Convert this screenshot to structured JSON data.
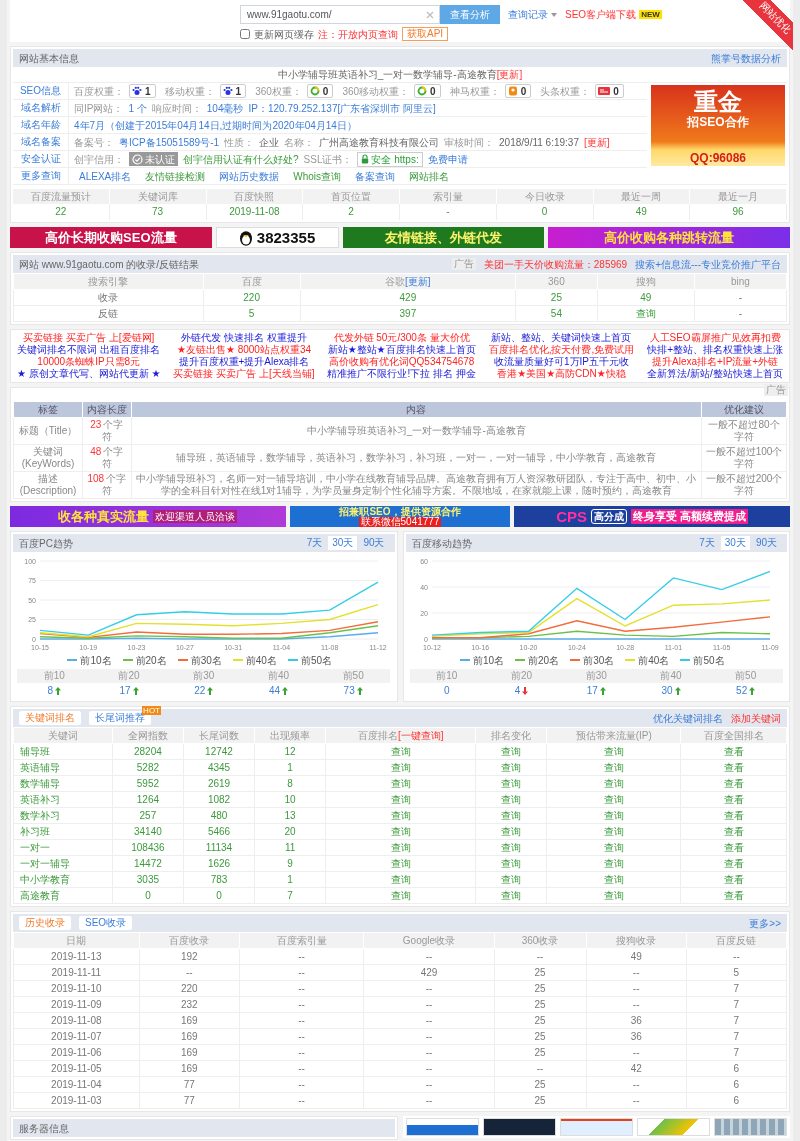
{
  "corner_ribbon": "网站优化",
  "search": {
    "value": "www.91gaotu.com/",
    "button": "查看分析",
    "history": "查询记录",
    "download": "SEO客户端下载",
    "download_badge": "NEW",
    "cache": {
      "label": "更新网页缓存",
      "checked": false
    },
    "note": "注：开放内页查询",
    "api": "获取API"
  },
  "basic_info": {
    "title": "网站基本信息",
    "link": "熊掌号数据分析",
    "site_title": "中小学辅导班英语补习_一对一数学辅导-高途教育",
    "site_update": "[更新]",
    "rows": [
      {
        "label": "SEO信息",
        "items": [
          {
            "kind": "label",
            "text": "百度权重："
          },
          {
            "kind": "weight",
            "text": "1"
          },
          {
            "kind": "label",
            "text": "移动权重："
          },
          {
            "kind": "weight",
            "text": "1"
          },
          {
            "kind": "label",
            "text": "360权重："
          },
          {
            "kind": "weight",
            "text": "0"
          },
          {
            "kind": "label",
            "text": "360移动权重："
          },
          {
            "kind": "weight",
            "text": "0"
          },
          {
            "kind": "label",
            "text": "神马权重："
          },
          {
            "kind": "weight",
            "text": "0"
          },
          {
            "kind": "label",
            "text": "头条权重："
          },
          {
            "kind": "weight",
            "text": "0"
          }
        ]
      },
      {
        "label": "域名解析",
        "items": [
          {
            "kind": "label",
            "text": "同IP网站："
          },
          {
            "kind": "value",
            "text": "1 个"
          },
          {
            "kind": "label",
            "text": "响应时间："
          },
          {
            "kind": "value",
            "text": "104毫秒"
          },
          {
            "kind": "value",
            "text": "IP：120.79.252.137[广东省深圳市 阿里云]"
          }
        ]
      },
      {
        "label": "域名年龄",
        "items": [
          {
            "kind": "value",
            "text": "4年7月（创建于2015年04月14日,过期时间为2020年04月14日）"
          }
        ]
      },
      {
        "label": "域名备案",
        "items": [
          {
            "kind": "label",
            "text": "备案号："
          },
          {
            "kind": "link",
            "text": "粤ICP备15051589号-1"
          },
          {
            "kind": "label",
            "text": "性质："
          },
          {
            "kind": "plain",
            "text": "企业"
          },
          {
            "kind": "label",
            "text": "名称："
          },
          {
            "kind": "plain",
            "text": "广州高途教育科技有限公司"
          },
          {
            "kind": "label",
            "text": "审核时间："
          },
          {
            "kind": "plain",
            "text": "2018/9/11 6:19:37"
          },
          {
            "kind": "update",
            "text": "[更新]"
          }
        ]
      },
      {
        "label": "安全认证",
        "items": [
          {
            "kind": "label",
            "text": "创宇信用："
          },
          {
            "kind": "cert",
            "text": "未认证"
          },
          {
            "kind": "green-link",
            "text": "创宇信用认证有什么好处?"
          },
          {
            "kind": "label",
            "text": "SSL证书："
          },
          {
            "kind": "ssl",
            "text": "安全 https:"
          },
          {
            "kind": "link",
            "text": "免费申请"
          }
        ]
      },
      {
        "label": "更多查询",
        "items": [
          {
            "kind": "link",
            "text": "ALEXA排名"
          },
          {
            "kind": "green-link",
            "text": "友情链接检测"
          },
          {
            "kind": "link",
            "text": "网站历史数据"
          },
          {
            "kind": "green-link",
            "text": "Whois查询"
          },
          {
            "kind": "link",
            "text": "备案查询"
          },
          {
            "kind": "green-link",
            "text": "网站排名"
          }
        ]
      }
    ],
    "ad": {
      "lines": [
        "重金",
        "招SEO合作",
        "QQ:96086"
      ]
    }
  },
  "stats": {
    "columns": [
      "百度流量预计",
      "关键词库",
      "百度快照",
      "首页位置",
      "索引量",
      "今日收录",
      "最近一周",
      "最近一月"
    ],
    "values": [
      "22",
      "73",
      "2019-11-08",
      "2",
      "-",
      "0",
      "49",
      "96"
    ]
  },
  "banners_top": [
    {
      "kind": "crimson",
      "lines": [
        "高价长期收购SEO流量"
      ]
    },
    {
      "kind": "qq",
      "lines": [
        "3823355"
      ]
    },
    {
      "kind": "green",
      "lines": [
        "友情链接、外链代发"
      ]
    },
    {
      "kind": "purple",
      "lines": [
        "高价收购各种跳转流量"
      ]
    }
  ],
  "inclusion": {
    "title": "网站 www.91gaotu.com 的收录/反链结果",
    "ad_tag": "广告",
    "promo": "美团一手天价收购流量：285969",
    "promo_link": "搜索+信息流---专业竞价推广平台",
    "columns": [
      {
        "text": "搜索引擎"
      },
      {
        "text": "百度"
      },
      {
        "text": "谷歌",
        "link": "[更新]"
      },
      {
        "text": "360"
      },
      {
        "text": "搜狗"
      },
      {
        "text": "bing"
      }
    ],
    "rows": [
      [
        "收录",
        "220",
        "429",
        "25",
        "49",
        "-"
      ],
      [
        "反链",
        "5",
        "397",
        "54",
        "查询",
        "-"
      ]
    ]
  },
  "ad_links": {
    "columns": [
      [
        {
          "text": "买卖链接 买卖广告 上[爱链网]",
          "kind": "accent"
        },
        {
          "text": "关键词排名不限词 出租百度排名",
          "kind": "plain"
        },
        {
          "text": "10000条蜘蛛IP只需8元",
          "kind": "accent"
        },
        {
          "text": "★ 原创文章代写、网站代更新 ★",
          "kind": "plain"
        }
      ],
      [
        {
          "text": "外链代发 快速排名 权重提升",
          "kind": "plain"
        },
        {
          "text": "★友链出售★ 8000站点权重34",
          "kind": "accent"
        },
        {
          "text": "提升百度权重+提升Alexa排名",
          "kind": "plain"
        },
        {
          "text": "买卖链接 买卖广告 上[天线当铺]",
          "kind": "accent"
        }
      ],
      [
        {
          "text": "代发外链 50元/300条 量大价优",
          "kind": "accent"
        },
        {
          "text": "新站★整站★百度排名快速上首页",
          "kind": "plain"
        },
        {
          "text": "高价收购有优化词QQ534754678",
          "kind": "accent"
        },
        {
          "text": "精准推广不限行业!下拉 排名 押金",
          "kind": "plain"
        }
      ],
      [
        {
          "text": "新站、整站、关键词快速上首页",
          "kind": "plain"
        },
        {
          "text": "百度排名优化,按天付费,免费试用",
          "kind": "accent"
        },
        {
          "text": "收流量质量好可1万IP五千元收",
          "kind": "plain"
        },
        {
          "text": "香港★美国★高防CDN★快稳",
          "kind": "accent"
        }
      ],
      [
        {
          "text": "人工SEO霸屏推广见效再扣费",
          "kind": "accent"
        },
        {
          "text": "快排+整站、排名权重快速上涨",
          "kind": "plain"
        },
        {
          "text": "提升Alexa排名+IP流量+外链",
          "kind": "accent"
        },
        {
          "text": "全新算法/新站/整站快速上首页",
          "kind": "plain"
        }
      ]
    ],
    "ad_tag": "广告"
  },
  "meta": {
    "columns": [
      "标签",
      "内容长度",
      "内容",
      "优化建议"
    ],
    "rows": [
      {
        "label": "标题（Title）",
        "count": "23",
        "unit": "个字符",
        "content": "中小学辅导班英语补习_一对一数学辅导-高途教育",
        "advice": "一般不超过80个字符"
      },
      {
        "label": "关键词 (KeyWords)",
        "count": "48",
        "unit": "个字符",
        "content": "辅导班，英语辅导，数学辅导，英语补习，数学补习，补习班，一对一，一对一辅导，中小学教育，高途教育",
        "advice": "一般不超过100个字符"
      },
      {
        "label": "描述 (Description)",
        "count": "108",
        "unit": "个字符",
        "content": "中小学辅导班补习，名师一对一辅导培训，中小学在线教育辅导品牌。高途教育拥有万人资深教研团队，专注于高中、初中、小学的全科目针对性在线1对1辅导，为学员量身定制个性化辅导方案。不限地域，在家就能上课，随时预约，高途教育",
        "advice": "一般不超过200个字符"
      }
    ]
  },
  "banners_mid": [
    {
      "kind": "violet",
      "lines": [
        "收各种真实流量",
        "欢迎渠道人员洽谈"
      ]
    },
    {
      "kind": "blue",
      "lines": [
        "招兼职SEO，提供资源合作",
        "联系微信5041777"
      ]
    },
    {
      "kind": "navy",
      "lines": [
        "CPS",
        "高分成",
        "终身享受 高额续费提成"
      ]
    }
  ],
  "trends": [
    {
      "title": "百度PC趋势",
      "ranges": [
        {
          "label": "7天",
          "selected": false
        },
        {
          "label": "30天",
          "selected": true
        },
        {
          "label": "90天",
          "selected": false
        }
      ],
      "chart_data": {
        "type": "line",
        "categories": [
          "10-15",
          "10-19",
          "10-23",
          "10-27",
          "10-31",
          "11-04",
          "11-08",
          "11-12"
        ],
        "ylim": [
          0,
          100
        ],
        "yticks": [
          0,
          25,
          50,
          75,
          100
        ],
        "grid": true,
        "legend": "bottom",
        "series": [
          {
            "name": "前10名",
            "color": "#5aaee6",
            "values": [
              0,
              0,
              1,
              0,
              0,
              0,
              3,
              8
            ]
          },
          {
            "name": "前20名",
            "color": "#6cc04a",
            "values": [
              3,
              1,
              4,
              3,
              1,
              1,
              8,
              17
            ]
          },
          {
            "name": "前30名",
            "color": "#f36c3d",
            "values": [
              7,
              2,
              9,
              6,
              6,
              7,
              11,
              22
            ]
          },
          {
            "name": "前40名",
            "color": "#e3e02e",
            "values": [
              8,
              3,
              20,
              19,
              17,
              20,
              25,
              44
            ]
          },
          {
            "name": "前50名",
            "color": "#35cde6",
            "values": [
              11,
              5,
              31,
              35,
              32,
              32,
              37,
              73
            ]
          }
        ]
      },
      "summary": [
        {
          "label": "前10",
          "value": "8",
          "kind": "up"
        },
        {
          "label": "前20",
          "value": "17",
          "kind": "up"
        },
        {
          "label": "前30",
          "value": "22",
          "kind": "up"
        },
        {
          "label": "前40",
          "value": "44",
          "kind": "up"
        },
        {
          "label": "前50",
          "value": "73",
          "kind": "up"
        }
      ]
    },
    {
      "title": "百度移动趋势",
      "ranges": [
        {
          "label": "7天",
          "selected": false
        },
        {
          "label": "30天",
          "selected": true
        },
        {
          "label": "90天",
          "selected": false
        }
      ],
      "chart_data": {
        "type": "line",
        "categories": [
          "10-12",
          "10-16",
          "10-20",
          "10-24",
          "10-28",
          "11-01",
          "11-05",
          "11-09"
        ],
        "ylim": [
          0,
          60
        ],
        "yticks": [
          0,
          20,
          40,
          60
        ],
        "grid": true,
        "legend": "bottom",
        "series": [
          {
            "name": "前10名",
            "color": "#5aaee6",
            "values": [
              0,
              0,
              0,
              0,
              0,
              0,
              0,
              0
            ]
          },
          {
            "name": "前20名",
            "color": "#6cc04a",
            "values": [
              1,
              1,
              2,
              6,
              3,
              2,
              5,
              4
            ]
          },
          {
            "name": "前30名",
            "color": "#f36c3d",
            "values": [
              1,
              1,
              4,
              14,
              6,
              9,
              13,
              17
            ]
          },
          {
            "name": "前40名",
            "color": "#e3e02e",
            "values": [
              2,
              4,
              5,
              31,
              10,
              26,
              27,
              30
            ]
          },
          {
            "name": "前50名",
            "color": "#35cde6",
            "values": [
              3,
              5,
              6,
              39,
              15,
              47,
              38,
              52
            ]
          }
        ]
      },
      "summary": [
        {
          "label": "前10",
          "value": "0",
          "kind": "none"
        },
        {
          "label": "前20",
          "value": "4",
          "kind": "down"
        },
        {
          "label": "前30",
          "value": "17",
          "kind": "up"
        },
        {
          "label": "前40",
          "value": "30",
          "kind": "up"
        },
        {
          "label": "前50",
          "value": "52",
          "kind": "up"
        }
      ]
    }
  ],
  "keywords": {
    "tabs": [
      {
        "label": "关键词排名",
        "selected": true
      },
      {
        "label": "长尾词推荐",
        "selected": false,
        "badge": "HOT"
      }
    ],
    "links": [
      "优化关键词排名",
      "添加关键词"
    ],
    "columns": [
      {
        "text": "关键词"
      },
      {
        "text": "全网指数"
      },
      {
        "text": "长尾词数"
      },
      {
        "text": "出现频率"
      },
      {
        "text": "百度排名",
        "link": "[一键查询]"
      },
      {
        "text": "排名变化"
      },
      {
        "text": "预估带来流量(IP)"
      },
      {
        "text": "百度全国排名"
      }
    ],
    "rows": [
      [
        "辅导班",
        "28204",
        "12742",
        "12",
        "查询",
        "查询",
        "查询",
        "查看"
      ],
      [
        "英语辅导",
        "5282",
        "4345",
        "1",
        "查询",
        "查询",
        "查询",
        "查看"
      ],
      [
        "数学辅导",
        "5952",
        "2619",
        "8",
        "查询",
        "查询",
        "查询",
        "查看"
      ],
      [
        "英语补习",
        "1264",
        "1082",
        "10",
        "查询",
        "查询",
        "查询",
        "查看"
      ],
      [
        "数学补习",
        "257",
        "480",
        "13",
        "查询",
        "查询",
        "查询",
        "查看"
      ],
      [
        "补习班",
        "34140",
        "5466",
        "20",
        "查询",
        "查询",
        "查询",
        "查看"
      ],
      [
        "一对一",
        "108436",
        "11134",
        "11",
        "查询",
        "查询",
        "查询",
        "查看"
      ],
      [
        "一对一辅导",
        "14472",
        "1626",
        "9",
        "查询",
        "查询",
        "查询",
        "查看"
      ],
      [
        "中小学教育",
        "3035",
        "783",
        "1",
        "查询",
        "查询",
        "查询",
        "查看"
      ],
      [
        "高途教育",
        "0",
        "0",
        "7",
        "查询",
        "查询",
        "查询",
        "查看"
      ]
    ]
  },
  "history": {
    "tabs": [
      {
        "label": "历史收录",
        "selected": true
      },
      {
        "label": "SEO收录",
        "selected": false
      }
    ],
    "more": "更多>>",
    "columns": [
      {
        "text": "日期"
      },
      {
        "text": "百度收录"
      },
      {
        "text": "百度索引量"
      },
      {
        "text": "Google收录"
      },
      {
        "text": "360收录"
      },
      {
        "text": "搜狗收录"
      },
      {
        "text": "百度反链"
      }
    ],
    "rows": [
      [
        "2019-11-13",
        "192",
        "--",
        "--",
        "--",
        "49",
        "--"
      ],
      [
        "2019-11-11",
        "--",
        "--",
        "429",
        "25",
        "--",
        "5"
      ],
      [
        "2019-11-10",
        "220",
        "--",
        "--",
        "25",
        "--",
        "7"
      ],
      [
        "2019-11-09",
        "232",
        "--",
        "--",
        "25",
        "--",
        "7"
      ],
      [
        "2019-11-08",
        "169",
        "--",
        "--",
        "25",
        "36",
        "7"
      ],
      [
        "2019-11-07",
        "169",
        "--",
        "--",
        "25",
        "36",
        "7"
      ],
      [
        "2019-11-06",
        "169",
        "--",
        "--",
        "25",
        "--",
        "7"
      ],
      [
        "2019-11-05",
        "169",
        "--",
        "--",
        "--",
        "42",
        "6"
      ],
      [
        "2019-11-04",
        "77",
        "--",
        "--",
        "25",
        "--",
        "6"
      ],
      [
        "2019-11-03",
        "77",
        "--",
        "--",
        "25",
        "--",
        "6"
      ]
    ]
  },
  "server": {
    "title": "服务器信息",
    "thumbnails": [
      {
        "kind": "seo"
      },
      {
        "kind": "dark"
      },
      {
        "kind": "web"
      },
      {
        "kind": "logo"
      },
      {
        "kind": "grid"
      }
    ]
  }
}
